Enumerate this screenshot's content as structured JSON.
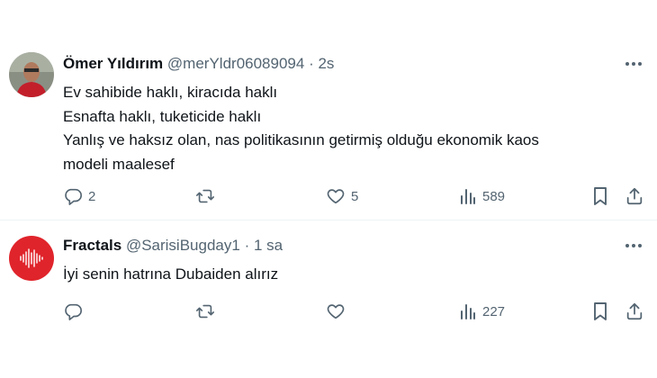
{
  "tweets": [
    {
      "author_name": "Ömer Yıldırım",
      "handle": "@merYldr06089094",
      "separator": "·",
      "time": "2s",
      "lines": [
        "Ev sahibide haklı, kiracıda haklı",
        "Esnafta haklı, tuketicide haklı",
        "Yanlış ve haksız olan, nas politikasının getirmiş olduğu ekonomik kaos",
        "modeli maalesef"
      ],
      "replies": "2",
      "retweets": "",
      "likes": "5",
      "views": "589"
    },
    {
      "author_name": "Fractals",
      "handle": "@SarisiBugday1",
      "separator": "·",
      "time": "1 sa",
      "lines": [
        "İyi senin hatrına Dubaiden alırız"
      ],
      "replies": "",
      "retweets": "",
      "likes": "",
      "views": "227"
    }
  ],
  "colors": {
    "text_primary": "#0f1419",
    "text_secondary": "#536471",
    "divider": "#eff3f4",
    "fractals_avatar_bg": "#e0242b"
  },
  "icons": [
    "more-icon",
    "reply-icon",
    "retweet-icon",
    "like-icon",
    "views-icon",
    "bookmark-icon",
    "share-icon"
  ]
}
